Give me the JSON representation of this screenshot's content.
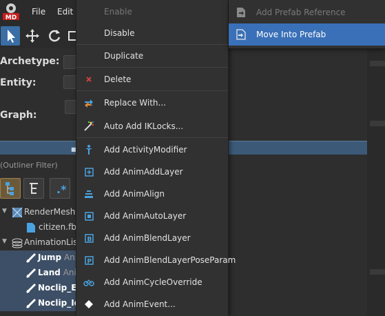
{
  "menubar": {
    "logo_text": "MD",
    "file": "File",
    "edit": "Edit"
  },
  "properties": {
    "archetype": "Archetype:",
    "entity": "Entity:",
    "graph": "Graph:"
  },
  "outliner": {
    "filter_placeholder": "(Outliner Filter)",
    "rows": [
      {
        "kind": "group",
        "label": "RenderMeshLi"
      },
      {
        "kind": "file",
        "label": "citizen.fbx"
      },
      {
        "kind": "group",
        "label": "AnimationList"
      },
      {
        "kind": "anim",
        "name": "Jump",
        "suffix": "Anim"
      },
      {
        "kind": "anim",
        "name": "Land",
        "suffix": "Anim"
      },
      {
        "kind": "anim",
        "name": "Noclip_E",
        "suffix": "A"
      },
      {
        "kind": "anim",
        "name": "Noclip_Idl",
        "suffix": ""
      }
    ]
  },
  "context_menu": {
    "items": [
      {
        "label": "Enable",
        "icon": "none",
        "enabled": false
      },
      {
        "label": "Disable",
        "icon": "none",
        "enabled": true
      },
      {
        "label": "Duplicate",
        "icon": "none",
        "enabled": true
      },
      {
        "label": "Delete",
        "icon": "red-x-icon",
        "enabled": true
      },
      {
        "label": "Replace With...",
        "icon": "replace-icon",
        "enabled": true
      },
      {
        "label": "Auto Add IKLocks...",
        "icon": "magic-wand-icon",
        "enabled": true
      },
      {
        "label": "Add ActivityModifier",
        "icon": "activity-modifier-icon",
        "enabled": true
      },
      {
        "label": "Add AnimAddLayer",
        "icon": "add-layer-icon",
        "enabled": true
      },
      {
        "label": "Add AnimAlign",
        "icon": "align-icon",
        "enabled": true
      },
      {
        "label": "Add AnimAutoLayer",
        "icon": "auto-layer-icon",
        "enabled": true
      },
      {
        "label": "Add AnimBlendLayer",
        "icon": "blend-layer-icon",
        "enabled": true
      },
      {
        "label": "Add AnimBlendLayerPoseParam",
        "icon": "blend-pose-param-icon",
        "enabled": true
      },
      {
        "label": "Add AnimCycleOverride",
        "icon": "cycle-override-icon",
        "enabled": true
      },
      {
        "label": "Add AnimEvent...",
        "icon": "event-diamond-icon",
        "enabled": true
      }
    ]
  },
  "submenu": {
    "items": [
      {
        "label": "Add Prefab Reference",
        "icon": "prefab-reference-icon",
        "enabled": false,
        "highlighted": false
      },
      {
        "label": "Move Into Prefab",
        "icon": "move-into-prefab-icon",
        "enabled": true,
        "highlighted": true
      }
    ]
  },
  "colors": {
    "highlight": "#3a70b8",
    "menu_bg": "#313131",
    "icon_blue": "#4aa3e0",
    "delete_red": "#d04040"
  }
}
